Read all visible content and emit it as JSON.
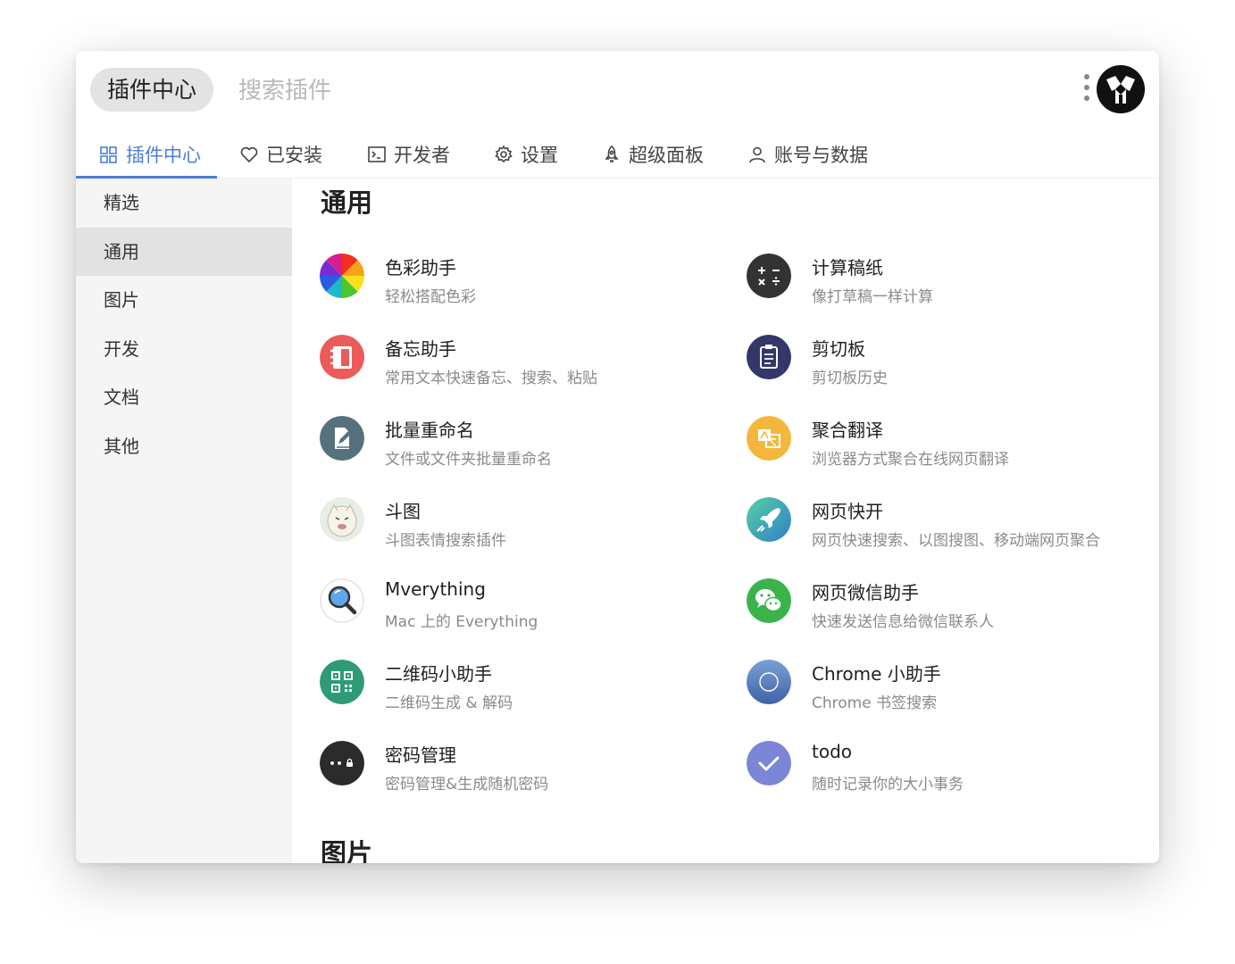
{
  "header": {
    "pill_label": "插件中心",
    "search_placeholder": "搜索插件"
  },
  "tabs": [
    {
      "label": "插件中心",
      "icon": "grid-icon",
      "active": true
    },
    {
      "label": "已安装",
      "icon": "heart-icon"
    },
    {
      "label": "开发者",
      "icon": "terminal-icon"
    },
    {
      "label": "设置",
      "icon": "gear-icon"
    },
    {
      "label": "超级面板",
      "icon": "rocket-icon"
    },
    {
      "label": "账号与数据",
      "icon": "user-icon"
    }
  ],
  "sidebar": {
    "items": [
      {
        "label": "精选"
      },
      {
        "label": "通用",
        "active": true
      },
      {
        "label": "图片"
      },
      {
        "label": "开发"
      },
      {
        "label": "文档"
      },
      {
        "label": "其他"
      }
    ]
  },
  "main": {
    "sections": [
      {
        "title": "通用",
        "plugins": [
          {
            "name": "色彩助手",
            "desc": "轻松搭配色彩",
            "icon": "color-wheel-icon"
          },
          {
            "name": "计算稿纸",
            "desc": "像打草稿一样计算",
            "icon": "calculator-icon",
            "color": "#333333"
          },
          {
            "name": "备忘助手",
            "desc": "常用文本快速备忘、搜索、粘贴",
            "icon": "memo-icon",
            "color": "#ec5a5a"
          },
          {
            "name": "剪切板",
            "desc": "剪切板历史",
            "icon": "clipboard-icon",
            "color": "#34376a"
          },
          {
            "name": "批量重命名",
            "desc": "文件或文件夹批量重命名",
            "icon": "rename-icon",
            "color": "#56707e"
          },
          {
            "name": "聚合翻译",
            "desc": "浏览器方式聚合在线网页翻译",
            "icon": "translate-icon",
            "color": "#f5b73b"
          },
          {
            "name": "斗图",
            "desc": "斗图表情搜索插件",
            "icon": "meme-face-icon"
          },
          {
            "name": "网页快开",
            "desc": "网页快速搜索、以图搜图、移动端网页聚合",
            "icon": "web-rocket-icon",
            "color": "#3fb8b0"
          },
          {
            "name": "Mverything",
            "desc": "Mac 上的 Everything",
            "icon": "magnifier-icon"
          },
          {
            "name": "网页微信助手",
            "desc": "快速发送信息给微信联系人",
            "icon": "wechat-icon",
            "color": "#3ab44a"
          },
          {
            "name": "二维码小助手",
            "desc": "二维码生成 & 解码",
            "icon": "qrcode-icon",
            "color": "#2f9a78"
          },
          {
            "name": "Chrome 小助手",
            "desc": "Chrome 书签搜索",
            "icon": "chrome-icon",
            "color": "#5b7fb8"
          },
          {
            "name": "密码管理",
            "desc": "密码管理&生成随机密码",
            "icon": "password-icon",
            "color": "#2b2b2b"
          },
          {
            "name": "todo",
            "desc": "随时记录你的大小事务",
            "icon": "check-icon",
            "color": "#7b86d6"
          }
        ]
      },
      {
        "title": "图片"
      }
    ]
  }
}
